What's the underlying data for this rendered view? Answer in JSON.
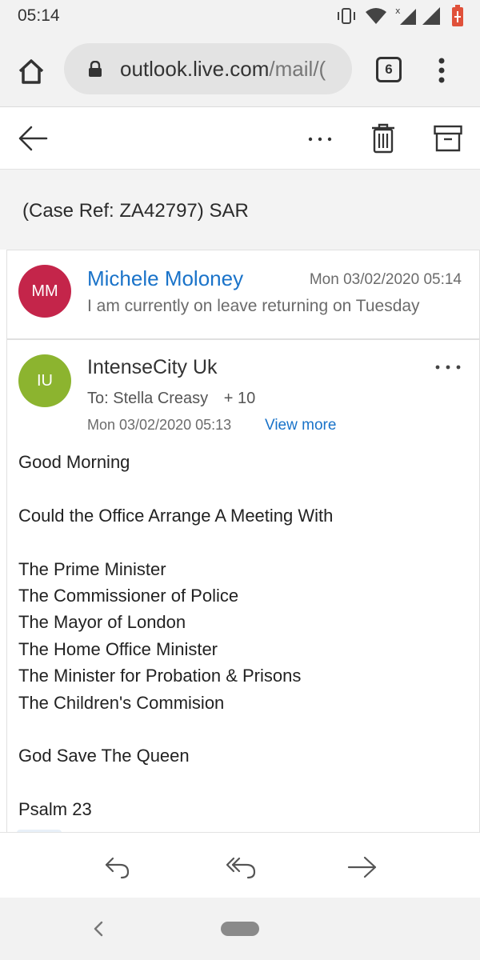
{
  "status_bar": {
    "time": "05:14",
    "icons": [
      "vibrate-icon",
      "wifi-icon",
      "signal-icon",
      "battery-icon"
    ]
  },
  "browser": {
    "url_host": "outlook.live.com",
    "url_path": "/mail/(",
    "tab_count": "6",
    "icons": [
      "home-icon",
      "lock-icon",
      "more-vertical-icon"
    ]
  },
  "toolbar": {
    "icons": [
      "back-arrow-icon",
      "more-horizontal-icon",
      "trash-icon",
      "archive-icon"
    ]
  },
  "subject": "(Case Ref: ZA42797) SAR",
  "messages": [
    {
      "initials": "MM",
      "avatar_color": "#c4254a",
      "sender": "Michele Moloney",
      "date": "Mon 03/02/2020 05:14",
      "preview": "I am currently on leave returning on Tuesday"
    },
    {
      "initials": "IU",
      "avatar_color": "#8cb42f",
      "sender": "IntenseCity Uk",
      "to_label": "To: Stella Creasy",
      "to_more": "+ 10",
      "date": "Mon 03/02/2020 05:13",
      "view_more": "View more",
      "body": {
        "greeting": "Good Morning",
        "request": "Could the Office Arrange A Meeting With",
        "recipients": [
          "The Prime Minister",
          "The Commissioner of Police",
          "The Mayor of London",
          "The Home Office Minister",
          "The Minister for Probation & Prisons",
          "The Children's Commision"
        ],
        "closing": "God Save The Queen",
        "signoff": "Psalm 23"
      }
    }
  ],
  "reply_bar": {
    "icons": [
      "reply-icon",
      "reply-all-icon",
      "forward-icon"
    ]
  },
  "colors": {
    "accent": "#1a73c9",
    "chrome_bg": "#f2f2f2"
  }
}
